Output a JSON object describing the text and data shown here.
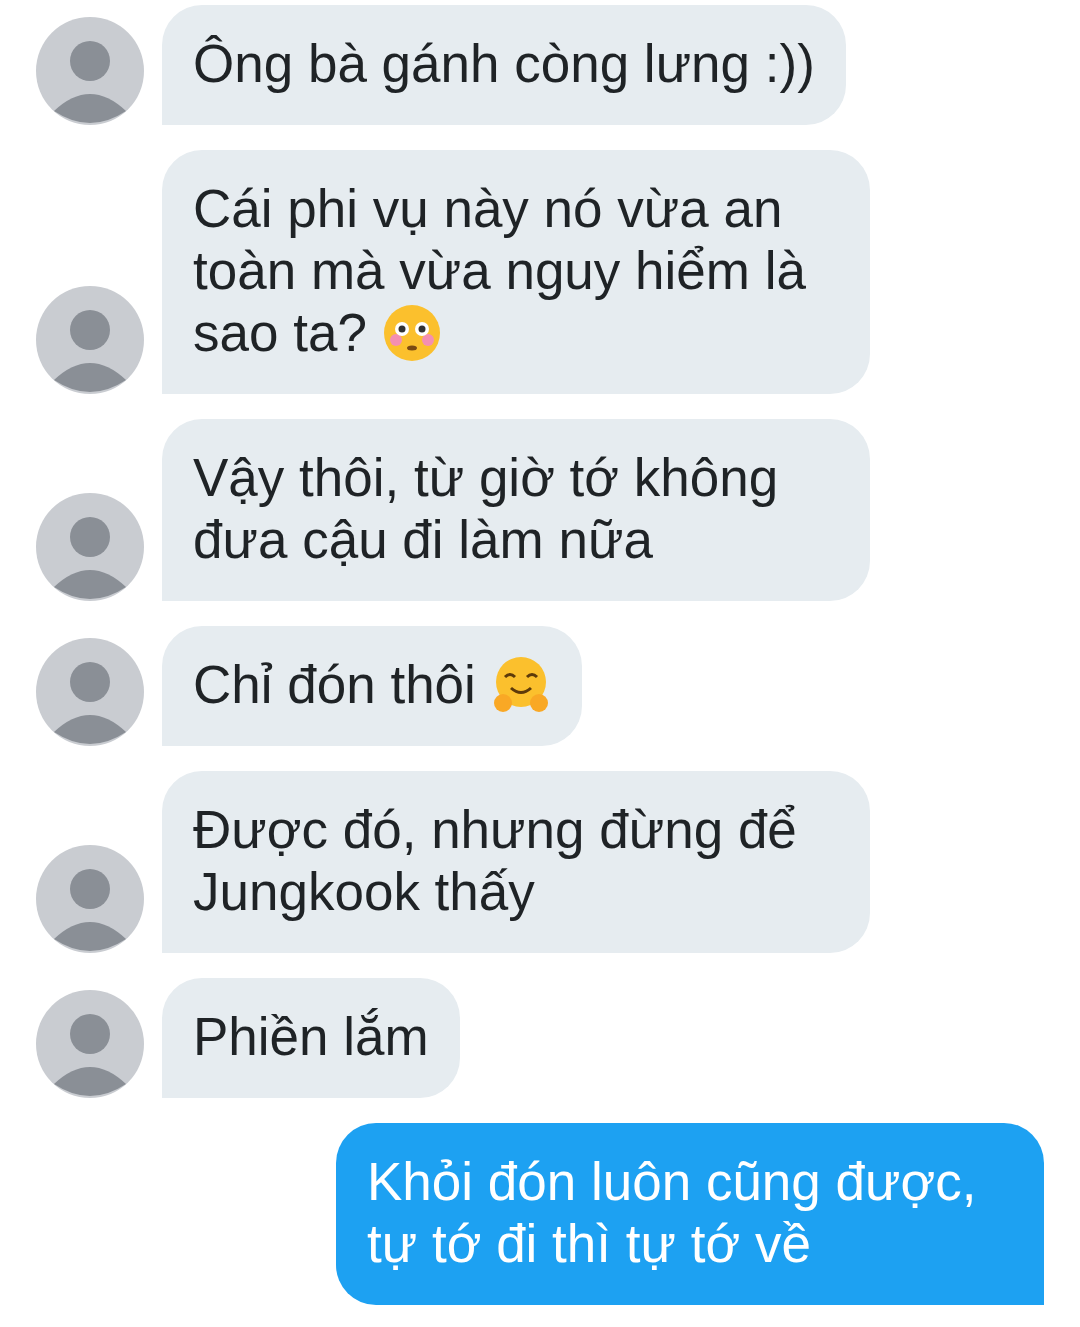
{
  "messages": [
    {
      "kind": "received",
      "text": "Ông bà gánh còng lưng :))"
    },
    {
      "kind": "received",
      "text": "Cái phi vụ này nó vừa an toàn mà vừa nguy hiểm là sao ta?",
      "emoji": {
        "kind": "flushed"
      }
    },
    {
      "kind": "received",
      "text": "Vậy thôi, từ giờ tớ không đưa cậu đi làm nữa"
    },
    {
      "kind": "received",
      "text": "Chỉ đón thôi",
      "emoji": {
        "kind": "hug"
      }
    },
    {
      "kind": "received",
      "text": "Được đó, nhưng đừng để Jungkook thấy"
    },
    {
      "kind": "received",
      "text": "Phiền lắm"
    },
    {
      "kind": "sent",
      "text": "Khỏi đón luôn cũng được, tự tớ đi thì tự tớ về"
    }
  ]
}
